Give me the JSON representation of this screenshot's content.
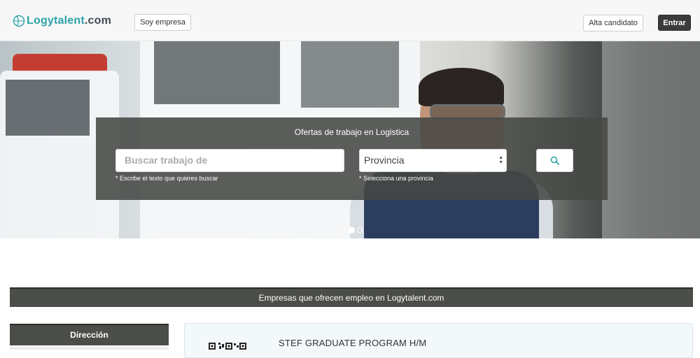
{
  "header": {
    "logo_text_main": "Logytalent",
    "logo_text_tld": ".com",
    "soy_empresa_label": "Soy empresa",
    "alta_candidato_label": "Alta candidato",
    "entrar_label": "Entrar"
  },
  "hero": {
    "search_title": "Ofertas de trabajo en Logistica",
    "job_input_placeholder": "Buscar trabajo de",
    "job_input_help": "* Escribe el texto que quieres buscar",
    "province_selected": "Provincia",
    "province_help": "* Selecciona una provincia",
    "carousel_active_index": 1
  },
  "companies_section": {
    "title": "Empresas que ofrecen empleo en Logytalent.com"
  },
  "sidebar": {
    "direccion_label": "Dirección"
  },
  "job_listing": {
    "title": "STEF GRADUATE PROGRAM H/M"
  },
  "colors": {
    "brand_teal": "#2aa3a8",
    "dark_button": "#3a3c3a",
    "bar_dark": "#4b4d48"
  }
}
